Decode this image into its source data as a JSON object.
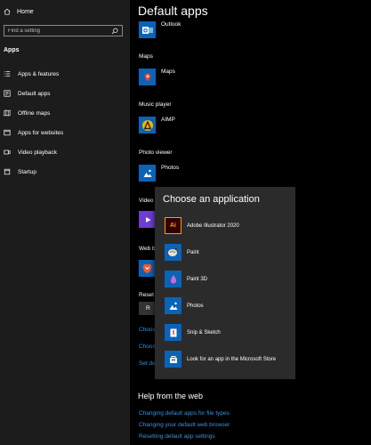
{
  "sidebar": {
    "home_label": "Home",
    "search_placeholder": "Find a setting",
    "section_label": "Apps",
    "items": [
      {
        "label": "Apps & features"
      },
      {
        "label": "Default apps"
      },
      {
        "label": "Offline maps"
      },
      {
        "label": "Apps for websites"
      },
      {
        "label": "Video playback"
      },
      {
        "label": "Startup"
      }
    ]
  },
  "main": {
    "title": "Default apps",
    "email_app": "Outlook",
    "maps_label": "Maps",
    "maps_app": "Maps",
    "music_label": "Music player",
    "music_app": "AIMP",
    "photo_label": "Photo viewer",
    "photo_app": "Photos",
    "video_label": "Video",
    "web_label": "Web b",
    "reset_label": "Reset a",
    "reset_button": "R",
    "link1": "Choos",
    "link2": "Choos",
    "link3": "Set de",
    "help_title": "Help from the web",
    "help_links": [
      "Changing default apps for file types",
      "Changing your default web browser",
      "Resetting default app settings"
    ]
  },
  "flyout": {
    "title": "Choose an application",
    "items": [
      {
        "label": "Adobe Illustrator 2020"
      },
      {
        "label": "Paint"
      },
      {
        "label": "Paint 3D"
      },
      {
        "label": "Photos"
      },
      {
        "label": "Snip & Sketch"
      },
      {
        "label": "Look for an app in the Microsoft Store"
      }
    ]
  },
  "colors": {
    "sidebar_bg": "#1c1c1c",
    "main_bg": "#000000",
    "flyout_bg": "#2b2b2b",
    "link": "#3a93e0",
    "tile_blue": "#0b63b6"
  }
}
